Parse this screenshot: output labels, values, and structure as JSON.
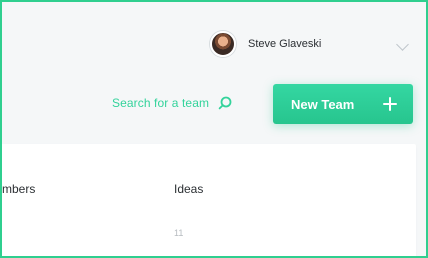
{
  "header": {
    "user": {
      "name": "Steve Glaveski"
    }
  },
  "toolbar": {
    "search_label": "Search for a team",
    "new_team_label": "New Team"
  },
  "table": {
    "columns": [
      "mbers",
      "Ideas"
    ],
    "rows": [
      {
        "ideas": "11"
      }
    ]
  },
  "colors": {
    "accent": "#2fcf8f",
    "accent_text": "#33d39b",
    "button_bg": "#27c58e",
    "text": "#2b2f33",
    "muted": "#b7bcc0",
    "page_bg": "#f5f7f8"
  },
  "icons": {
    "search": "search-icon",
    "plus": "plus-icon",
    "dropdown": "chevron-down-icon",
    "avatar": "avatar"
  }
}
